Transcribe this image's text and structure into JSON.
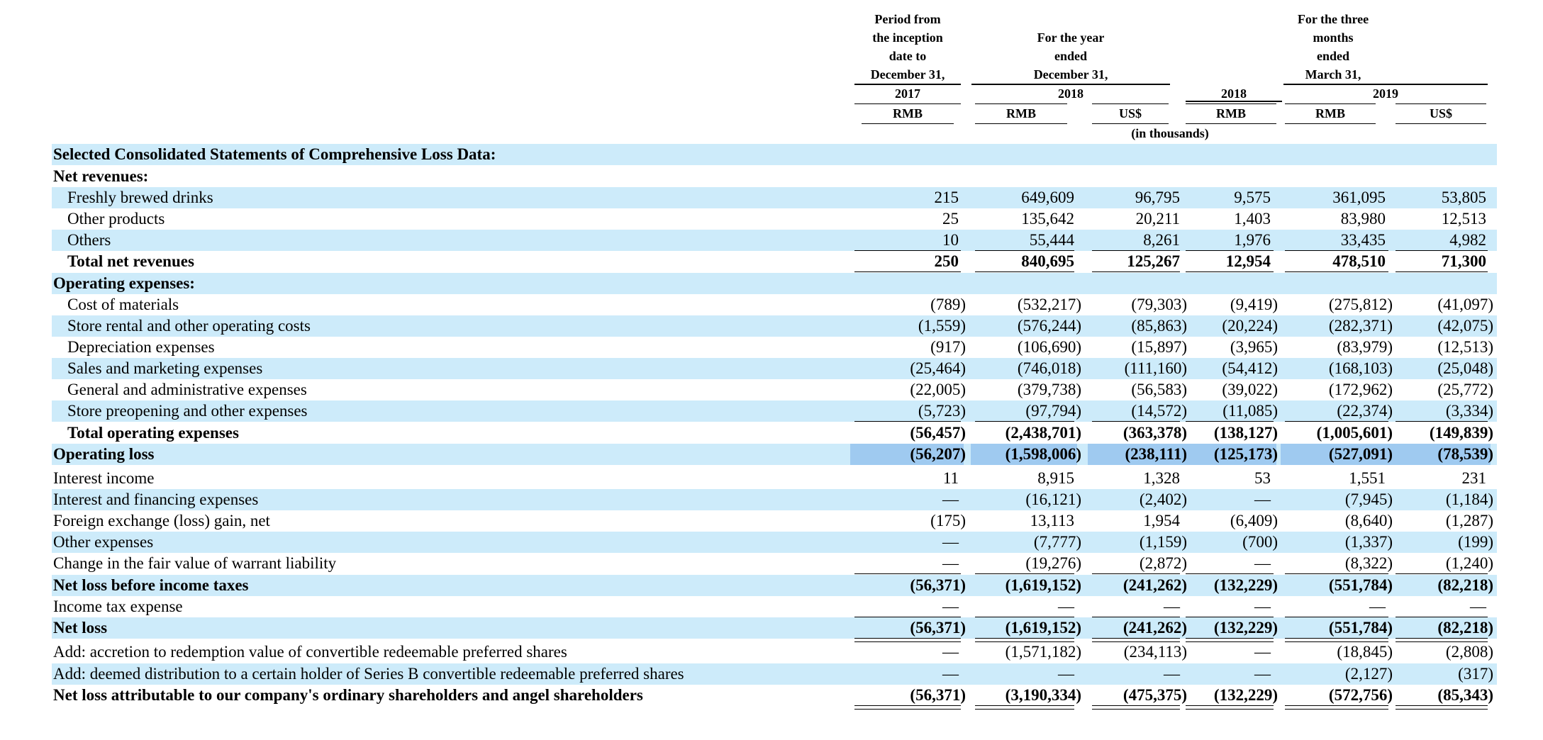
{
  "header": {
    "col1": [
      "Period from",
      "the inception",
      "date to",
      "December 31,"
    ],
    "col2": [
      "For the year",
      "ended",
      "December 31,"
    ],
    "col3": [
      "For the three",
      "months",
      "ended",
      "March 31,"
    ],
    "years": [
      "2017",
      "2018",
      "2018",
      "2019"
    ],
    "units": [
      "RMB",
      "RMB",
      "US$",
      "RMB",
      "RMB",
      "US$"
    ],
    "in_thousands": "(in thousands)"
  },
  "rows": [
    {
      "label": "Selected Consolidated Statements of Comprehensive Loss Data:",
      "bold": true,
      "indent": false,
      "values": []
    },
    {
      "label": "Net revenues:",
      "bold": true,
      "indent": false,
      "values": []
    },
    {
      "label": "Freshly brewed drinks",
      "bold": false,
      "indent": true,
      "values": [
        "215",
        "649,609",
        "96,795",
        "9,575",
        "361,095",
        "53,805"
      ]
    },
    {
      "label": "Other products",
      "bold": false,
      "indent": true,
      "values": [
        "25",
        "135,642",
        "20,211",
        "1,403",
        "83,980",
        "12,513"
      ]
    },
    {
      "label": "Others",
      "bold": false,
      "indent": true,
      "values": [
        "10",
        "55,444",
        "8,261",
        "1,976",
        "33,435",
        "4,982"
      ]
    },
    {
      "label": "Total net revenues",
      "bold": true,
      "indent": true,
      "values": [
        "250",
        "840,695",
        "125,267",
        "12,954",
        "478,510",
        "71,300"
      ]
    },
    {
      "label": "Operating expenses:",
      "bold": true,
      "indent": false,
      "values": []
    },
    {
      "label": "Cost of materials",
      "bold": false,
      "indent": true,
      "values": [
        "(789)",
        "(532,217)",
        "(79,303)",
        "(9,419)",
        "(275,812)",
        "(41,097)"
      ]
    },
    {
      "label": "Store rental and other operating costs",
      "bold": false,
      "indent": true,
      "values": [
        "(1,559)",
        "(576,244)",
        "(85,863)",
        "(20,224)",
        "(282,371)",
        "(42,075)"
      ]
    },
    {
      "label": "Depreciation expenses",
      "bold": false,
      "indent": true,
      "values": [
        "(917)",
        "(106,690)",
        "(15,897)",
        "(3,965)",
        "(83,979)",
        "(12,513)"
      ]
    },
    {
      "label": "Sales and marketing expenses",
      "bold": false,
      "indent": true,
      "values": [
        "(25,464)",
        "(746,018)",
        "(111,160)",
        "(54,412)",
        "(168,103)",
        "(25,048)"
      ]
    },
    {
      "label": "General and administrative expenses",
      "bold": false,
      "indent": true,
      "values": [
        "(22,005)",
        "(379,738)",
        "(56,583)",
        "(39,022)",
        "(172,962)",
        "(25,772)"
      ]
    },
    {
      "label": "Store preopening and other expenses",
      "bold": false,
      "indent": true,
      "values": [
        "(5,723)",
        "(97,794)",
        "(14,572)",
        "(11,085)",
        "(22,374)",
        "(3,334)"
      ]
    },
    {
      "label": "Total operating expenses",
      "bold": true,
      "indent": true,
      "values": [
        "(56,457)",
        "(2,438,701)",
        "(363,378)",
        "(138,127)",
        "(1,005,601)",
        "(149,839)"
      ]
    },
    {
      "label": "Operating loss",
      "bold": true,
      "indent": false,
      "values": [
        "(56,207)",
        "(1,598,006)",
        "(238,111)",
        "(125,173)",
        "(527,091)",
        "(78,539)"
      ]
    },
    {
      "label": "Interest income",
      "bold": false,
      "indent": false,
      "values": [
        "11",
        "8,915",
        "1,328",
        "53",
        "1,551",
        "231"
      ]
    },
    {
      "label": "Interest and financing expenses",
      "bold": false,
      "indent": false,
      "values": [
        "—",
        "(16,121)",
        "(2,402)",
        "—",
        "(7,945)",
        "(1,184)"
      ]
    },
    {
      "label": "Foreign exchange (loss) gain, net",
      "bold": false,
      "indent": false,
      "values": [
        "(175)",
        "13,113",
        "1,954",
        "(6,409)",
        "(8,640)",
        "(1,287)"
      ]
    },
    {
      "label": "Other expenses",
      "bold": false,
      "indent": false,
      "values": [
        "—",
        "(7,777)",
        "(1,159)",
        "(700)",
        "(1,337)",
        "(199)"
      ]
    },
    {
      "label": "Change in the fair value of warrant liability",
      "bold": false,
      "indent": false,
      "values": [
        "—",
        "(19,276)",
        "(2,872)",
        "—",
        "(8,322)",
        "(1,240)"
      ]
    },
    {
      "label": "Net loss before income taxes",
      "bold": true,
      "indent": false,
      "values": [
        "(56,371)",
        "(1,619,152)",
        "(241,262)",
        "(132,229)",
        "(551,784)",
        "(82,218)"
      ]
    },
    {
      "label": "Income tax expense",
      "bold": false,
      "indent": false,
      "values": [
        "—",
        "—",
        "—",
        "—",
        "—",
        "—"
      ]
    },
    {
      "label": "Net loss",
      "bold": true,
      "indent": false,
      "values": [
        "(56,371)",
        "(1,619,152)",
        "(241,262)",
        "(132,229)",
        "(551,784)",
        "(82,218)"
      ]
    },
    {
      "label": "Add: accretion to redemption value of convertible redeemable preferred shares",
      "bold": false,
      "indent": false,
      "values": [
        "—",
        "(1,571,182)",
        "(234,113)",
        "—",
        "(18,845)",
        "(2,808)"
      ]
    },
    {
      "label": "Add: deemed distribution to a certain holder of Series B convertible redeemable preferred shares",
      "bold": false,
      "indent": false,
      "values": [
        "—",
        "—",
        "—",
        "—",
        "(2,127)",
        "(317)"
      ]
    },
    {
      "label": "Net loss attributable to our company's ordinary shareholders and angel shareholders",
      "bold": true,
      "indent": false,
      "values": [
        "(56,371)",
        "(3,190,334)",
        "(475,375)",
        "(132,229)",
        "(572,756)",
        "(85,343)"
      ]
    }
  ]
}
